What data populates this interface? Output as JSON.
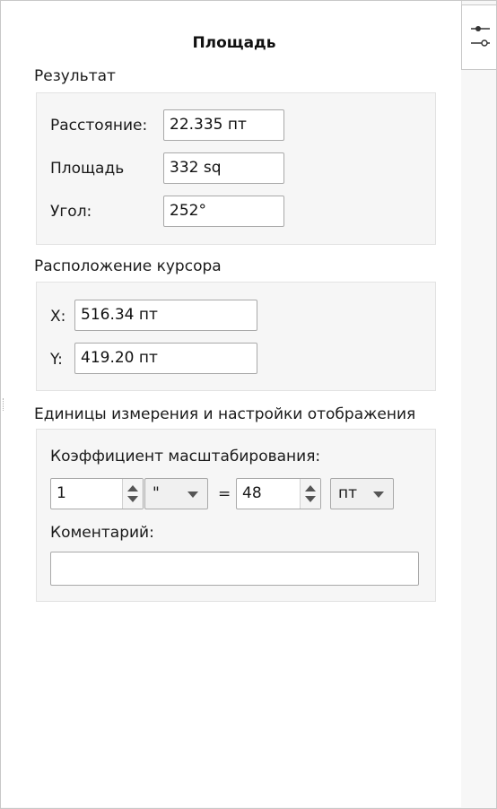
{
  "panel": {
    "title": "Площадь"
  },
  "result": {
    "heading": "Результат",
    "distance_label": "Расстояние:",
    "distance_value": "22.335 пт",
    "area_label": "Площадь",
    "area_value": "332 sq",
    "angle_label": "Угол:",
    "angle_value": "252°"
  },
  "cursor": {
    "heading": "Расположение курсора",
    "x_label": "X:",
    "x_value": "516.34 пт",
    "y_label": "Y:",
    "y_value": "419.20 пт"
  },
  "units": {
    "heading": "Единицы измерения и настройки отображения",
    "scale_label": "Коэффициент масштабирования:",
    "scale_left_value": "1",
    "scale_left_unit": "\"",
    "equals": "=",
    "scale_right_value": "48",
    "scale_right_unit": "пт",
    "comment_label": "Коментарий:",
    "comment_value": ""
  },
  "sidebar": {
    "icon": "sliders-icon"
  },
  "colors": {
    "panel_bg": "#ffffff",
    "group_bg": "#f6f6f6",
    "border": "#a9a9a9"
  }
}
